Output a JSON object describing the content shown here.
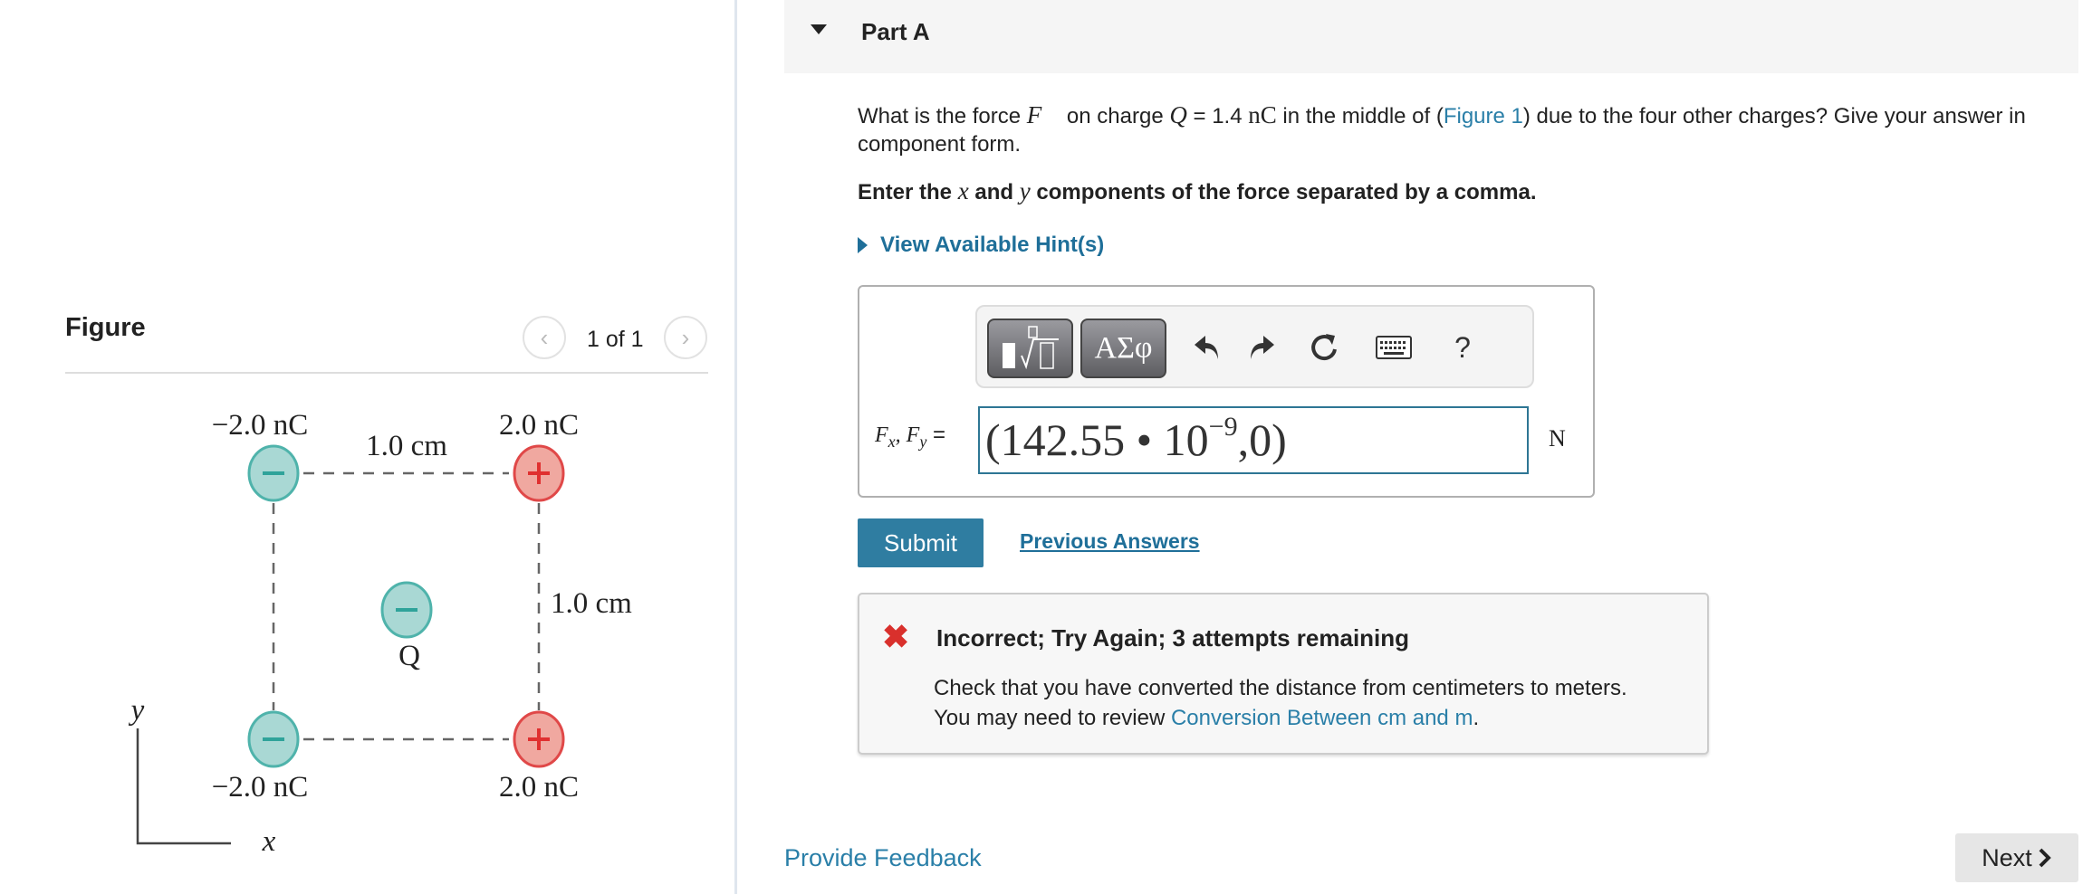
{
  "part": {
    "title": "Part A"
  },
  "question": {
    "text_1": "What is the force ",
    "force_symbol": "F⃗",
    "text_2": " on charge ",
    "charge_symbol": "Q",
    "text_3": " = 1.4 ",
    "charge_unit": "nC",
    "text_4": " in the middle of (",
    "figure_link": "Figure 1",
    "text_5": ") due to the four other charges? Give your answer in component form.",
    "instruction_1": "Enter the ",
    "instruction_x": "x",
    "instruction_2": " and ",
    "instruction_y": "y",
    "instruction_3": " components of the force separated by a comma."
  },
  "hint": {
    "label": "View Available Hint(s)"
  },
  "toolbar": {
    "templates_icon": "fraction-root-icon",
    "symbols_label": "ΑΣφ",
    "undo_icon": "undo-icon",
    "redo_icon": "redo-icon",
    "reset_icon": "reset-icon",
    "keyboard_icon": "keyboard-icon",
    "help_label": "?"
  },
  "answer": {
    "label_f": "F",
    "label_x": "x",
    "label_sep": ", ",
    "label_y": "y",
    "label_eq": " =",
    "value_main": "(142.55 • 10",
    "value_exp": "−9",
    "value_tail": ",0)",
    "unit": "N"
  },
  "buttons": {
    "submit": "Submit",
    "previous_answers": "Previous Answers",
    "provide_feedback": "Provide Feedback",
    "next": "Next"
  },
  "feedback": {
    "status": "incorrect",
    "title": "Incorrect; Try Again; 3 attempts remaining",
    "line_1": "Check that you have converted the distance from centimeters to meters.",
    "line_2_prefix": "You may need to review ",
    "line_2_link": "Conversion Between cm and m",
    "line_2_suffix": "."
  },
  "figure": {
    "title": "Figure",
    "pager": "1 of 1",
    "charges": {
      "top_left": "−2.0 nC",
      "top_right": "2.0 nC",
      "bottom_left": "−2.0 nC",
      "bottom_right": "2.0 nC",
      "center": "Q"
    },
    "spacing_top": "1.0 cm",
    "spacing_right": "1.0 cm",
    "axis_x": "x",
    "axis_y": "y"
  },
  "colors": {
    "accent": "#2f7da1",
    "link": "#2a7fa8",
    "error": "#d9302c",
    "negative_charge": "#a9d8d4",
    "positive_charge": "#f0a8a0"
  }
}
